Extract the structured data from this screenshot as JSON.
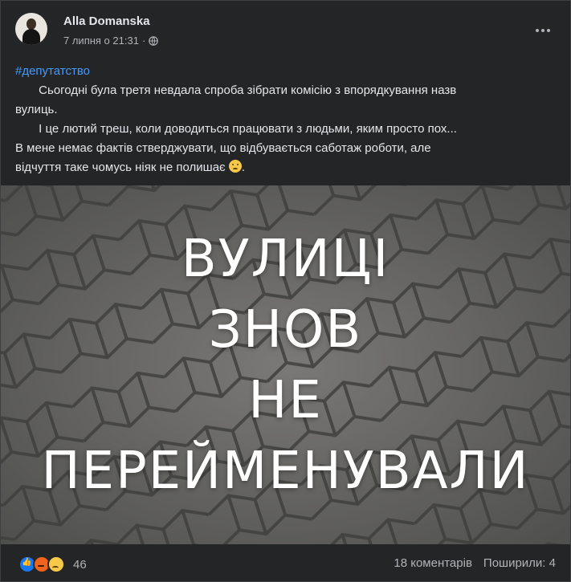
{
  "post": {
    "author": "Alla Domanska",
    "time": "7 липня о 21:31",
    "separator": "·",
    "privacy_icon": "globe-icon",
    "more_icon": "more-horizontal-icon"
  },
  "text": {
    "hashtag": "#депутатство",
    "line1": "       Сьогодні була третя невдала спроба зібрати комісію з впорядкування назв",
    "line2": "вулиць.",
    "line3": "       І це лютий треш, коли доводиться працювати з людьми, яким просто пох...",
    "line4": "В мене немає фактів стверджувати, що відбувається саботаж роботи, але",
    "line5": "відчуття таке чомусь ніяк не полишає",
    "line5_end": ".",
    "emoji": "sad-face-emoji"
  },
  "image": {
    "lines": [
      "ВУЛИЦІ",
      "ЗНОВ",
      "НЕ",
      "ПЕРЕЙМЕНУВАЛИ"
    ],
    "background": "paving-stones"
  },
  "footer": {
    "reaction_icons": [
      "like-icon",
      "angry-icon",
      "sad-icon"
    ],
    "reaction_count": "46",
    "comments": "18 коментарів",
    "shares": "Поширили: 4"
  },
  "colors": {
    "background": "#242526",
    "text": "#e4e6eb",
    "secondary": "#b0b3b8",
    "hashtag": "#4599ff"
  }
}
